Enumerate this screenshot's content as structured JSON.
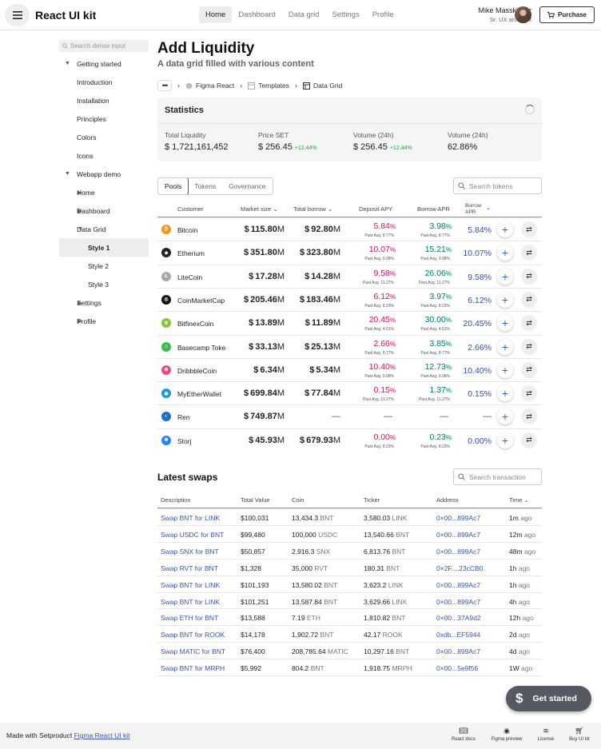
{
  "header": {
    "app_title": "React UI kit",
    "nav": [
      "Home",
      "Dashboard",
      "Data grid",
      "Settings",
      "Profile"
    ],
    "active_nav": "Home",
    "user_name": "Mike Masskicker",
    "user_role": "Sr. UX architect",
    "purchase_label": "Purchase"
  },
  "sidebar": {
    "search_placeholder": "Search dense input",
    "items": [
      {
        "label": "Getting started",
        "level": 0,
        "caret": "down"
      },
      {
        "label": "Introduction",
        "level": 1
      },
      {
        "label": "Installation",
        "level": 1
      },
      {
        "label": "Principles",
        "level": 1
      },
      {
        "label": "Colors",
        "level": 1
      },
      {
        "label": "Icons",
        "level": 1
      },
      {
        "label": "Webapp demo",
        "level": 0,
        "caret": "down"
      },
      {
        "label": "Home",
        "level": 1,
        "caret": "right"
      },
      {
        "label": "Dashboard",
        "level": 1,
        "caret": "right"
      },
      {
        "label": "Data Grid",
        "level": 1,
        "caret": "down"
      },
      {
        "label": "Style 1",
        "level": 2,
        "active": true
      },
      {
        "label": "Style 2",
        "level": 2
      },
      {
        "label": "Style 3",
        "level": 2
      },
      {
        "label": "Settings",
        "level": 1,
        "caret": "right"
      },
      {
        "label": "Profile",
        "level": 1,
        "caret": "right"
      }
    ]
  },
  "page": {
    "title": "Add Liquidity",
    "subtitle": "A data grid filled with various content",
    "breadcrumbs": [
      "Figma React",
      "Templates",
      "Data Grid"
    ]
  },
  "stats": {
    "title": "Statistics",
    "items": [
      {
        "label": "Total Liquidity",
        "value": "$ 1,721,161,452",
        "change": ""
      },
      {
        "label": "Price SET",
        "value": "$ 256.45",
        "change": "+12.44%"
      },
      {
        "label": "Volume (24h)",
        "value": "$ 256.45",
        "change": "+12.44%"
      },
      {
        "label": "Volume (24h)",
        "value": "62.86%",
        "change": ""
      }
    ]
  },
  "tabs": [
    "Pools",
    "Tokens",
    "Governance"
  ],
  "active_tab": "Pools",
  "search_tokens_placeholder": "Search tokens",
  "pools": {
    "columns": {
      "customer": "Customer",
      "market_size": "Market size",
      "total_borrow": "Total borrow",
      "deposit_apy": "Deposit APY",
      "borrow_apr": "Borrow APR",
      "borrow_apr2_line1": "Borrow",
      "borrow_apr2_line2": "APR"
    },
    "past_label": "Past Avg.",
    "rows": [
      {
        "name": "Bitcoin",
        "icon": "bitcoin-icon",
        "color": "#f7931a",
        "glyph": "₿",
        "market": "115.80",
        "borrow": "92.80",
        "dep": "5.84",
        "dep_past": "8.77",
        "bor": "3.98",
        "bor_past": "8.77",
        "apr": "5.84"
      },
      {
        "name": "Etherium",
        "icon": "ethereum-icon",
        "color": "#222222",
        "glyph": "◆",
        "market": "351.80",
        "borrow": "323.80",
        "dep": "10.07",
        "dep_past": "9.08",
        "bor": "15.21",
        "bor_past": "9.08",
        "apr": "10.07"
      },
      {
        "name": "LiteCoin",
        "icon": "litecoin-icon",
        "color": "#a6a9aa",
        "glyph": "Ł",
        "market": "17.28",
        "borrow": "14.28",
        "dep": "9.58",
        "dep_past": "11.27",
        "bor": "26.06",
        "bor_past": "11.27",
        "apr": "9.58"
      },
      {
        "name": "CoinMarketCap",
        "icon": "coinmarketcap-icon",
        "color": "#111111",
        "glyph": "◎",
        "market": "205.46",
        "borrow": "183.46",
        "dep": "6.12",
        "dep_past": "8.23",
        "bor": "3.97",
        "bor_past": "8.23",
        "apr": "6.12"
      },
      {
        "name": "BitfinexCoin",
        "icon": "bitfinex-icon",
        "color": "#8ac43f",
        "glyph": "❦",
        "market": "13.89",
        "borrow": "11.89",
        "dep": "20.45",
        "dep_past": "4.51",
        "bor": "30.00",
        "bor_past": "4.51",
        "apr": "20.45"
      },
      {
        "name": "Basecamp Toke",
        "icon": "basecamp-icon",
        "color": "#3fb950",
        "glyph": "☺",
        "market": "33.13",
        "borrow": "25.13",
        "dep": "2.66",
        "dep_past": "8.77",
        "bor": "3.85",
        "bor_past": "8.77",
        "apr": "2.66"
      },
      {
        "name": "DribbbleCoin",
        "icon": "dribbble-icon",
        "color": "#ea4c89",
        "glyph": "⊛",
        "market": "6.34",
        "borrow": "5.34",
        "dep": "10.40",
        "dep_past": "9.08",
        "bor": "12.73",
        "bor_past": "9.08",
        "apr": "10.40"
      },
      {
        "name": "MyEtherWallet",
        "icon": "myetherwallet-icon",
        "color": "#1a9ad6",
        "glyph": "◉",
        "market": "699.84",
        "borrow": "77.84",
        "dep": "0.15",
        "dep_past": "11.27",
        "bor": "1.37",
        "bor_past": "11.27",
        "apr": "0.15"
      },
      {
        "name": "Ren",
        "icon": "ren-icon",
        "color": "#1f6fc5",
        "glyph": "◐",
        "market": "749.87",
        "borrow": "",
        "dep": "",
        "dep_past": "",
        "bor": "",
        "bor_past": "",
        "apr": ""
      },
      {
        "name": "Storj",
        "icon": "storj-icon",
        "color": "#2683ff",
        "glyph": "✱",
        "market": "45.93",
        "borrow": "679.93",
        "dep": "0.00",
        "dep_past": "8.23",
        "bor": "0.23",
        "bor_past": "8.23",
        "apr": "0.00"
      }
    ]
  },
  "swaps": {
    "title": "Latest swaps",
    "search_placeholder": "Search transaction",
    "columns": [
      "Description",
      "Total Value",
      "Coin",
      "Ticker",
      "Address",
      "Time"
    ],
    "rows": [
      {
        "desc": "Swap BNT for LINK",
        "total": "$100,031",
        "coin_amt": "13,434.3",
        "coin_sym": "BNT",
        "tick_amt": "3,580.03",
        "tick_sym": "LINK",
        "addr": "0×00...899Ac7",
        "time_v": "1m",
        "time_u": "ago"
      },
      {
        "desc": "Swap USDC for BNT",
        "total": "$99,480",
        "coin_amt": "100,000",
        "coin_sym": "USDC",
        "tick_amt": "13,540.66",
        "tick_sym": "BNT",
        "addr": "0×00...899Ac7",
        "time_v": "12m",
        "time_u": "ago"
      },
      {
        "desc": "Swap SNX for BNT",
        "total": "$50,857",
        "coin_amt": "2,916.3",
        "coin_sym": "SNX",
        "tick_amt": "6,813.76",
        "tick_sym": "BNT",
        "addr": "0×00...899Ac7",
        "time_v": "48m",
        "time_u": "ago"
      },
      {
        "desc": "Swap RVT for BNT",
        "total": "$1,328",
        "coin_amt": "35,000",
        "coin_sym": "RVT",
        "tick_amt": "180.31",
        "tick_sym": "BNT",
        "addr": "0×2F....23cCB0",
        "time_v": "1h",
        "time_u": "ago"
      },
      {
        "desc": "Swap BNT for LINK",
        "total": "$101,193",
        "coin_amt": "13,580.02",
        "coin_sym": "BNT",
        "tick_amt": "3,623.2",
        "tick_sym": "LINK",
        "addr": "0×00...899Ac7",
        "time_v": "1h",
        "time_u": "ago"
      },
      {
        "desc": "Swap BNT for LINK",
        "total": "$101,251",
        "coin_amt": "13,587.84",
        "coin_sym": "BNT",
        "tick_amt": "3,629.66",
        "tick_sym": "LINK",
        "addr": "0×00...899Ac7",
        "time_v": "4h",
        "time_u": "ago"
      },
      {
        "desc": "Swap ETH for BNT",
        "total": "$13,588",
        "coin_amt": "7.19",
        "coin_sym": "ETH",
        "tick_amt": "1,810.82",
        "tick_sym": "BNT",
        "addr": "0×00...37A9d2",
        "time_v": "12h",
        "time_u": "ago"
      },
      {
        "desc": "Swap BNT for ROOK",
        "total": "$14,178",
        "coin_amt": "1,902.72",
        "coin_sym": "BNT",
        "tick_amt": "42.17",
        "tick_sym": "ROOK",
        "addr": "0xdb...EF5944",
        "time_v": "2d",
        "time_u": "ago"
      },
      {
        "desc": "Swap MATIC for BNT",
        "total": "$76,400",
        "coin_amt": "208,785.64",
        "coin_sym": "MATIC",
        "tick_amt": "10,297.16",
        "tick_sym": "BNT",
        "addr": "0×00...899Ac7",
        "time_v": "4d",
        "time_u": "ago"
      },
      {
        "desc": "Swap BNT for MRPH",
        "total": "$5,992",
        "coin_amt": "804.2",
        "coin_sym": "BNT",
        "tick_amt": "1,918.75",
        "tick_sym": "MRPH",
        "addr": "0×00...5e9f56",
        "time_v": "1W",
        "time_u": "ago"
      }
    ]
  },
  "cta_label": "Get started",
  "footer": {
    "text": "Made with Setproduct",
    "link": "Figma React UI kit",
    "icons": [
      {
        "label": "React docs",
        "icon": "book-icon"
      },
      {
        "label": "Figma preview",
        "icon": "eye-icon"
      },
      {
        "label": "License",
        "icon": "license-icon"
      },
      {
        "label": "Buy UI kit",
        "icon": "cart-icon"
      }
    ]
  },
  "colors": {
    "red": "#c2185b",
    "teal": "#00796b",
    "blue": "#3a4fa0",
    "link": "#3b55a5",
    "green": "#2e9a4a"
  }
}
